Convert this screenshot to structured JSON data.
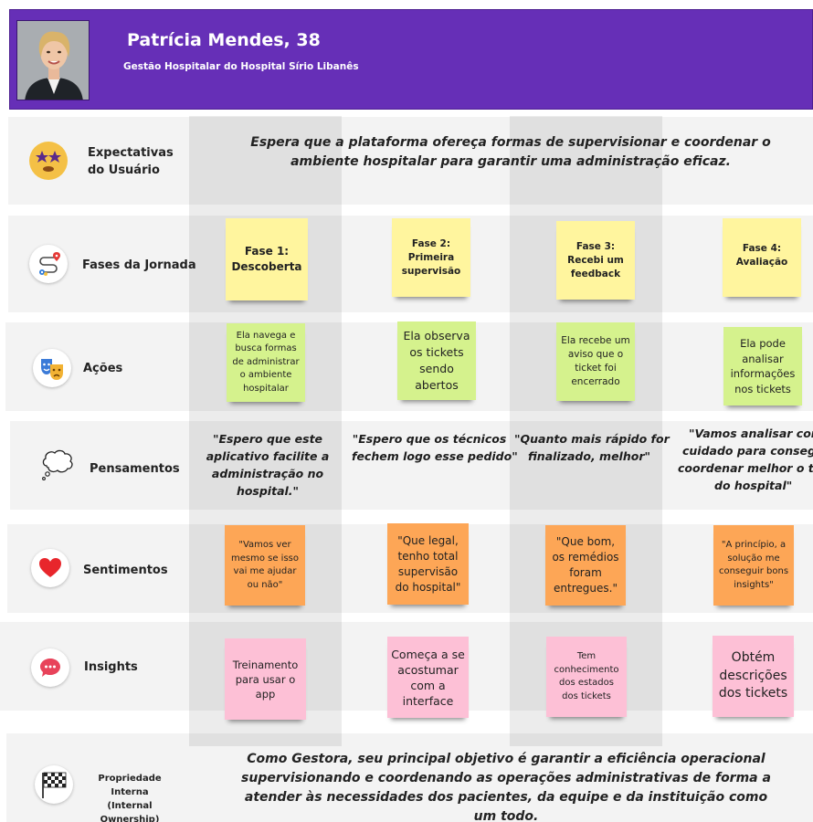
{
  "persona": {
    "name": "Patrícia Mendes, 38",
    "role": "Gestão Hospitalar do Hospital Sírio Libanês"
  },
  "rows": {
    "expectations": {
      "label_line1": "Expectativas",
      "label_line2": "do Usuário",
      "icon": "star-struck-face-icon",
      "text": "Espera que a plataforma ofereça formas de supervisionar e coordenar o ambiente hospitalar para garantir uma administração eficaz."
    },
    "phases": {
      "label": "Fases da Jornada",
      "icon": "route-map-icon"
    },
    "actions": {
      "label": "Ações",
      "icon": "theater-masks-icon"
    },
    "thoughts": {
      "label": "Pensamentos",
      "icon": "thought-bubble-icon"
    },
    "feelings": {
      "label": "Sentimentos",
      "icon": "red-heart-icon"
    },
    "insights": {
      "label": "Insights",
      "icon": "speech-bubble-icon"
    },
    "ownership": {
      "label_line1": "Propriedade Interna",
      "label_line2": "(Internal Ownership)",
      "icon": "checkered-flag-icon",
      "text": "Como Gestora, seu principal objetivo é garantir a eficiência operacional supervisionando e coordenando as operações administrativas de forma a  atender às necessidades dos pacientes, da equipe e da instituição como  um todo."
    }
  },
  "phases": [
    {
      "line1": "Fase 1:",
      "line2": "Descoberta"
    },
    {
      "line1": "Fase 2:",
      "line2": "Primeira",
      "line3": "supervisão"
    },
    {
      "line1": "Fase 3:",
      "line2": "Recebi um",
      "line3": "feedback"
    },
    {
      "line1": "Fase 4:",
      "line2": "Avaliação"
    }
  ],
  "actions": [
    "Ela navega e busca formas de administrar o ambiente hospitalar",
    "Ela observa os tickets sendo abertos",
    "Ela recebe um aviso que o ticket foi encerrado",
    "Ela pode analisar informações nos tickets"
  ],
  "thoughts": [
    {
      "l1": "\"Espero que este",
      "l2": "aplicativo facilite a",
      "l3": "administração no",
      "l4": "hospital.\""
    },
    {
      "l1": "\"Espero que os técnicos",
      "l2": "fechem logo esse pedido\""
    },
    {
      "l1": "\"Quanto mais rápido for",
      "l2": "finalizado, melhor\""
    },
    {
      "l1": "\"Vamos analisar com",
      "l2": "cuidado para conseguir",
      "l3": "coordenar melhor o time",
      "l4": "do hospital\""
    }
  ],
  "feelings": [
    "\"Vamos ver mesmo se isso vai me ajudar ou não\"",
    "\"Que legal, tenho total supervisão do hospital\"",
    "\"Que bom, os remédios foram entregues.\"",
    "\"A princípio, a solução me conseguir bons insights\""
  ],
  "insights": [
    "Treinamento para usar o app",
    "Começa a se acostumar com a interface",
    "Tem conhecimento dos estados dos tickets",
    "Obtém descrições dos tickets"
  ],
  "colors": {
    "header": "#662fb7",
    "note_yellow": "#fff59e",
    "note_green": "#d5f28d",
    "note_orange": "#fda656",
    "note_pink": "#fdc0d6"
  }
}
